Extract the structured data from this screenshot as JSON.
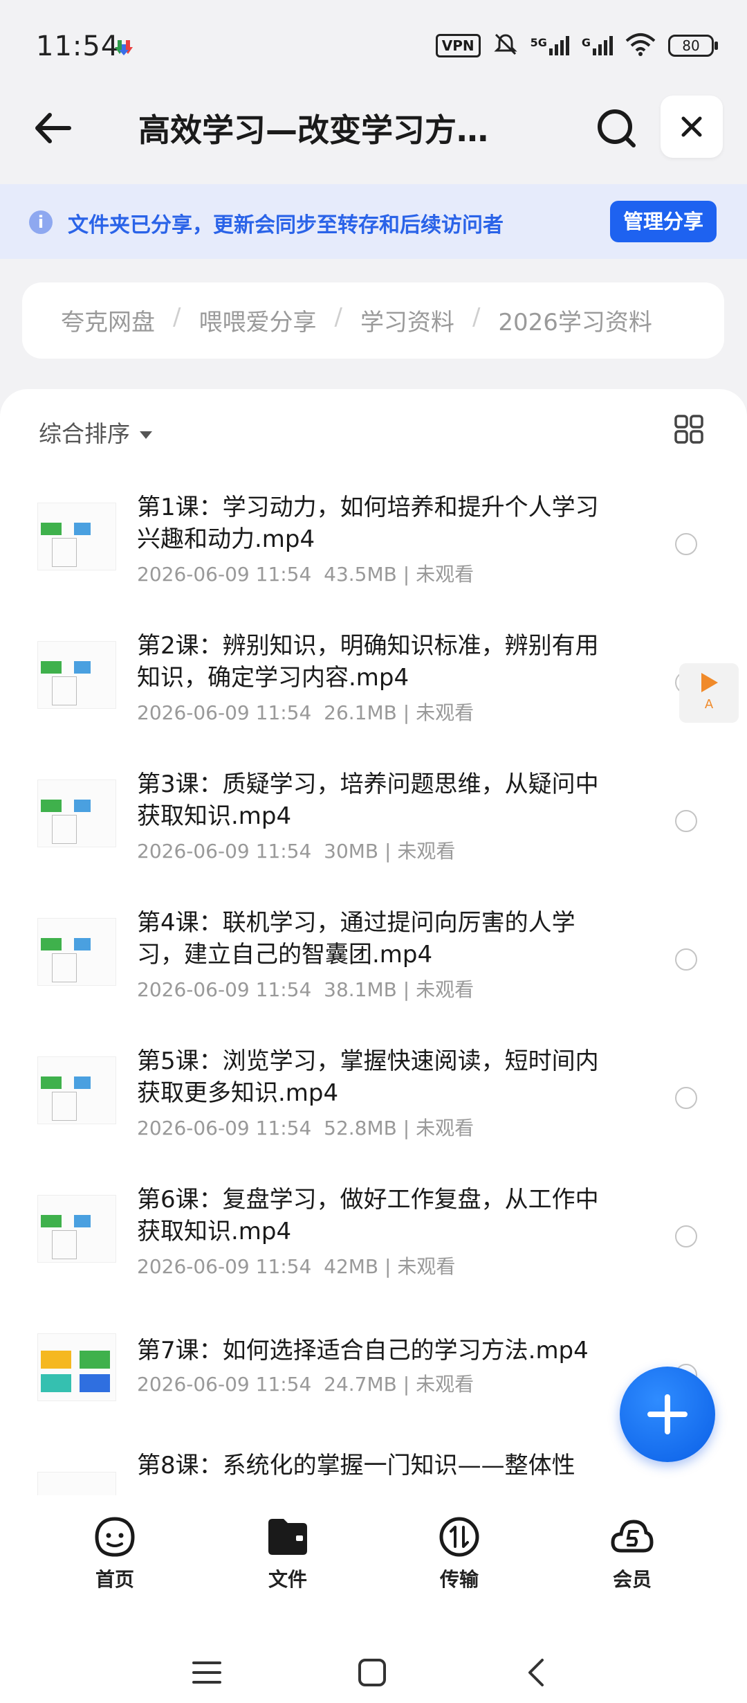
{
  "status_bar": {
    "time": "11:54",
    "vpn": "VPN",
    "net1": "5G",
    "net2": "G",
    "battery": "80"
  },
  "header": {
    "title": "高效学习—改变学习方…"
  },
  "banner": {
    "text": "文件夹已分享，更新会同步至转存和后续访问者",
    "manage_label": "管理分享"
  },
  "breadcrumb": {
    "items": [
      "夸克网盘",
      "喂喂爱分享",
      "学习资料",
      "2026学习资料"
    ]
  },
  "list": {
    "sort_label": "综合排序",
    "files": [
      {
        "name": "第1课：学习动力，如何培养和提升个人学习兴趣和动力.mp4",
        "date": "2026-06-09 11:54",
        "size": "43.5MB",
        "status": "未观看"
      },
      {
        "name": "第2课：辨别知识，明确知识标准，辨别有用知识，确定学习内容.mp4",
        "date": "2026-06-09 11:54",
        "size": "26.1MB",
        "status": "未观看"
      },
      {
        "name": "第3课：质疑学习，培养问题思维，从疑问中获取知识.mp4",
        "date": "2026-06-09 11:54",
        "size": "30MB",
        "status": "未观看"
      },
      {
        "name": "第4课：联机学习，通过提问向厉害的人学习，建立自己的智囊团.mp4",
        "date": "2026-06-09 11:54",
        "size": "38.1MB",
        "status": "未观看"
      },
      {
        "name": "第5课：浏览学习，掌握快速阅读，短时间内获取更多知识.mp4",
        "date": "2026-06-09 11:54",
        "size": "52.8MB",
        "status": "未观看"
      },
      {
        "name": "第6课：复盘学习，做好工作复盘，从工作中获取知识.mp4",
        "date": "2026-06-09 11:54",
        "size": "42MB",
        "status": "未观看"
      },
      {
        "name": "第7课：如何选择适合自己的学习方法.mp4",
        "date": "2026-06-09 11:54",
        "size": "24.7MB",
        "status": "未观看"
      },
      {
        "name": "第8课：系统化的掌握一门知识——整体性",
        "date": "",
        "size": "",
        "status": ""
      }
    ]
  },
  "floating_badge": "A",
  "bottom_nav": {
    "items": [
      "首页",
      "文件",
      "传输",
      "会员"
    ]
  },
  "colors": {
    "accent": "#1e62f0",
    "banner_bg": "#e6ebfb"
  }
}
